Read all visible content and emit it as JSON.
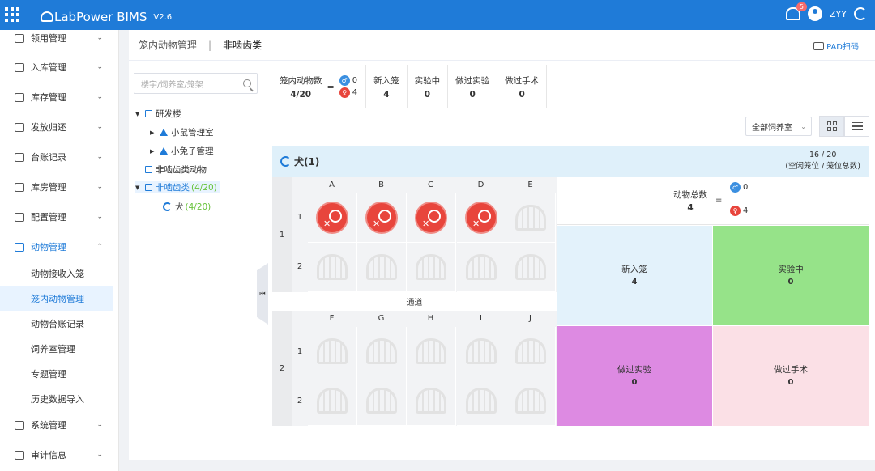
{
  "topbar": {
    "logo": "LabPower BIMS",
    "version": "V2.6",
    "notif_count": "5",
    "user": "ZYY"
  },
  "sidebar": {
    "menu": [
      {
        "label": "领用管理",
        "arrow": "⌄"
      },
      {
        "label": "入库管理",
        "arrow": "⌄"
      },
      {
        "label": "库存管理",
        "arrow": "⌄"
      },
      {
        "label": "发放归还",
        "arrow": "⌄"
      },
      {
        "label": "台账记录",
        "arrow": "⌄"
      },
      {
        "label": "库房管理",
        "arrow": "⌄"
      },
      {
        "label": "配置管理",
        "arrow": "⌄"
      },
      {
        "label": "动物管理",
        "arrow": "⌃"
      }
    ],
    "submenu": [
      "动物接收入笼",
      "笼内动物管理",
      "动物台账记录",
      "饲养室管理",
      "专题管理",
      "历史数据导入"
    ],
    "bottom": [
      {
        "label": "系统管理",
        "arrow": "⌄"
      },
      {
        "label": "审计信息",
        "arrow": "⌄"
      }
    ]
  },
  "header": {
    "title": "笼内动物管理",
    "subtitle": "非啮齿类",
    "pad": "PAD扫码"
  },
  "search": {
    "placeholder": "楼宇/饲养室/笼架"
  },
  "tree": {
    "n1": "研发楼",
    "n2": "小鼠管理室",
    "n3": "小兔子管理",
    "n4": "非啮齿类动物",
    "n5": "非啮齿类",
    "n5_count": "(4/20)",
    "n6": "犬",
    "n6_count": "(4/20)"
  },
  "stats": {
    "cage_label": "笼内动物数",
    "cage_value": "4/20",
    "male": "0",
    "female": "4",
    "items": [
      {
        "label": "新入笼",
        "value": "4"
      },
      {
        "label": "实验中",
        "value": "0"
      },
      {
        "label": "做过实验",
        "value": "0"
      },
      {
        "label": "做过手术",
        "value": "0"
      }
    ]
  },
  "room_select": "全部饲养室",
  "section": {
    "title": "犬(1)",
    "ratio": "16 / 20",
    "ratio_label": "(空闲笼位 / 笼位总数)"
  },
  "grid": {
    "rows": [
      "1",
      "2"
    ],
    "cols_top": [
      "A",
      "B",
      "C",
      "D",
      "E"
    ],
    "cols_bottom": [
      "F",
      "G",
      "H",
      "I",
      "J"
    ],
    "cage_rows": [
      "1",
      "2"
    ],
    "aisle": "通道"
  },
  "summary": {
    "total_label": "动物总数",
    "total": "4",
    "eq": "=",
    "male": "0",
    "female": "4",
    "tiles": [
      {
        "label": "新入笼",
        "value": "4",
        "color": "#e3f2fb"
      },
      {
        "label": "实验中",
        "value": "0",
        "color": "#96e389"
      },
      {
        "label": "做过实验",
        "value": "0",
        "color": "#dd8ae2"
      },
      {
        "label": "做过手术",
        "value": "0",
        "color": "#fbe0e6"
      }
    ]
  }
}
